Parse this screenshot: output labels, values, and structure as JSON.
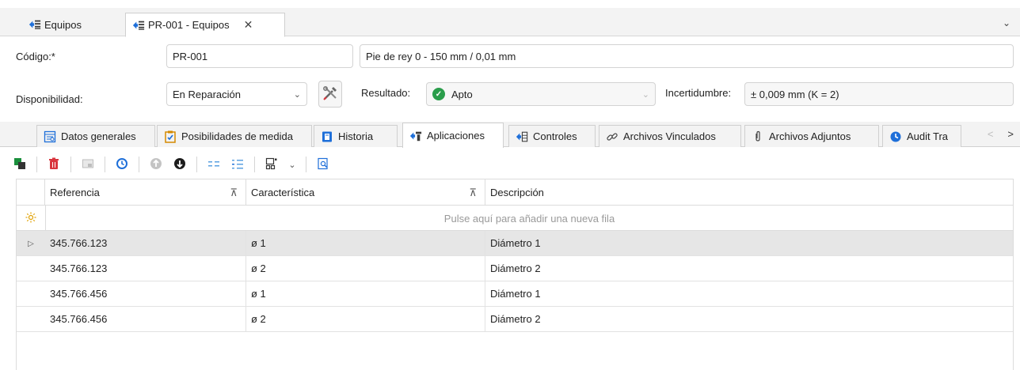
{
  "doc_tabs": [
    {
      "label": "Equipos",
      "icon": "equipment-icon"
    },
    {
      "label": "PR-001 - Equipos",
      "icon": "equipment-icon",
      "close": "✕"
    }
  ],
  "tabbar_chevron": "⌄",
  "form": {
    "codigo_label": "Código:*",
    "codigo_value": "PR-001",
    "descripcion_value": "Pie de rey 0 - 150 mm / 0,01 mm",
    "disponibilidad_label": "Disponibilidad:",
    "disponibilidad_value": "En Reparación",
    "resultado_label": "Resultado:",
    "resultado_value": "Apto",
    "incertidumbre_label": "Incertidumbre:",
    "incertidumbre_value": "± 0,009 mm (K = 2)"
  },
  "sub_tabs": [
    {
      "label": "Datos generales",
      "icon": "general-data-icon"
    },
    {
      "label": "Posibilidades de medida",
      "icon": "checklist-icon"
    },
    {
      "label": "Historia",
      "icon": "history-book-icon"
    },
    {
      "label": "Aplicaciones",
      "icon": "applications-icon",
      "active": true
    },
    {
      "label": "Controles",
      "icon": "controls-icon"
    },
    {
      "label": "Archivos Vinculados",
      "icon": "link-icon"
    },
    {
      "label": "Archivos Adjuntos",
      "icon": "paperclip-icon"
    },
    {
      "label": "Audit Tra",
      "icon": "audit-trail-icon"
    }
  ],
  "grid": {
    "columns": [
      "Referencia",
      "Característica",
      "Descripción"
    ],
    "new_row_text": "Pulse aquí para añadir una nueva fila",
    "rows": [
      {
        "referencia": "345.766.123",
        "caracteristica": "ø 1",
        "descripcion": "Diámetro 1"
      },
      {
        "referencia": "345.766.123",
        "caracteristica": "ø 2",
        "descripcion": "Diámetro 2"
      },
      {
        "referencia": "345.766.456",
        "caracteristica": "ø 1",
        "descripcion": "Diámetro 1"
      },
      {
        "referencia": "345.766.456",
        "caracteristica": "ø 2",
        "descripcion": "Diámetro 2"
      }
    ]
  },
  "colors": {
    "accent_blue": "#1e6fd9",
    "ok_green": "#2a9d4b",
    "delete_red": "#d9363e",
    "selected_row": "#e6e6e6"
  }
}
